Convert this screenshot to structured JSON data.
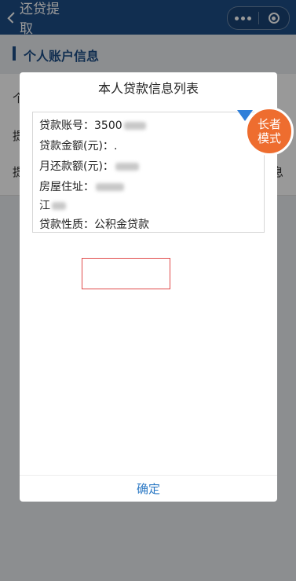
{
  "header": {
    "title": "还贷提取",
    "more_icon": "more-dots-icon",
    "close_icon": "target-close-icon",
    "colors": {
      "header_bg": "#1d4d86"
    }
  },
  "section": {
    "title": "个人账户信息"
  },
  "background_rows": {
    "row1_fragment": "个",
    "row2_fragment": "提",
    "row3_fragment": "提",
    "row3_right_fragment": "息"
  },
  "modal": {
    "title": "本人贷款信息列表",
    "fields": {
      "loan_account_label": "贷款账号：",
      "loan_account_value": "3500",
      "loan_amount_label": "贷款金额(元)：",
      "loan_amount_value": ".",
      "monthly_payment_label": "月还款额(元)：",
      "address_label": "房屋住址：",
      "address_value_line1": "",
      "address_value_line2": "江",
      "loan_type_label": "贷款性质：",
      "loan_type_value": "公积金贷款"
    },
    "confirm_label": "确定",
    "colors": {
      "highlight_border": "#e14b4b",
      "confirm_text": "#2a78c4"
    }
  },
  "elder_mode": {
    "line1": "长者",
    "line2": "模式",
    "color": "#ee6d2f"
  }
}
